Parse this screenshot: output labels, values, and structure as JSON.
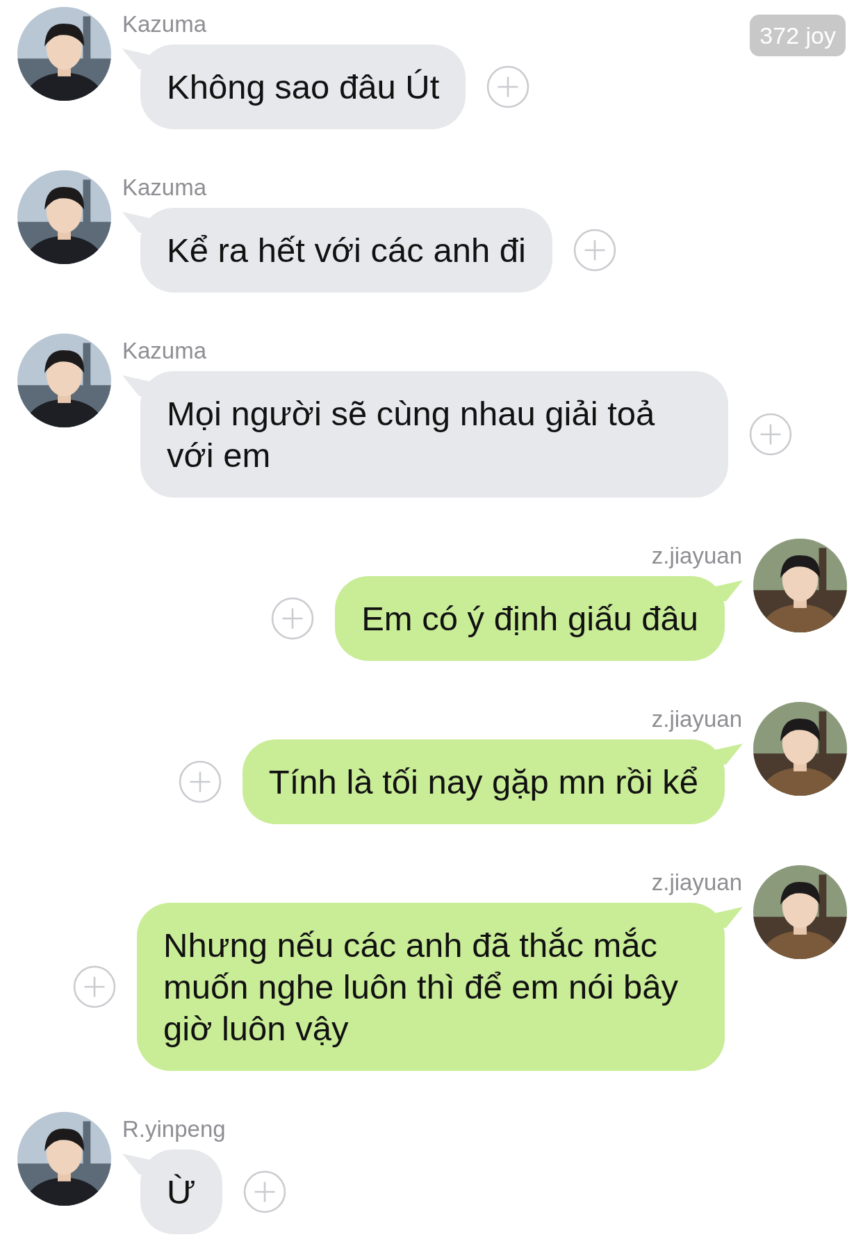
{
  "badge": "372 joy",
  "messages": [
    {
      "kind": "incoming",
      "sender": "Kazuma",
      "text": "Không sao đâu Út"
    },
    {
      "kind": "incoming",
      "sender": "Kazuma",
      "text": "Kể ra hết với các anh đi"
    },
    {
      "kind": "incoming",
      "sender": "Kazuma",
      "text": "Mọi người sẽ cùng nhau giải toả với em"
    },
    {
      "kind": "outgoing",
      "sender": "z.jiayuan",
      "text": "Em có ý định giấu đâu"
    },
    {
      "kind": "outgoing",
      "sender": "z.jiayuan",
      "text": "Tính là tối nay gặp mn rồi kể"
    },
    {
      "kind": "outgoing",
      "sender": "z.jiayuan",
      "text": "Nhưng nếu các anh đã thắc mắc muốn nghe luôn thì để em nói bây giờ luôn vậy"
    },
    {
      "kind": "incoming",
      "sender": "R.yinpeng",
      "text": "Ừ"
    }
  ]
}
